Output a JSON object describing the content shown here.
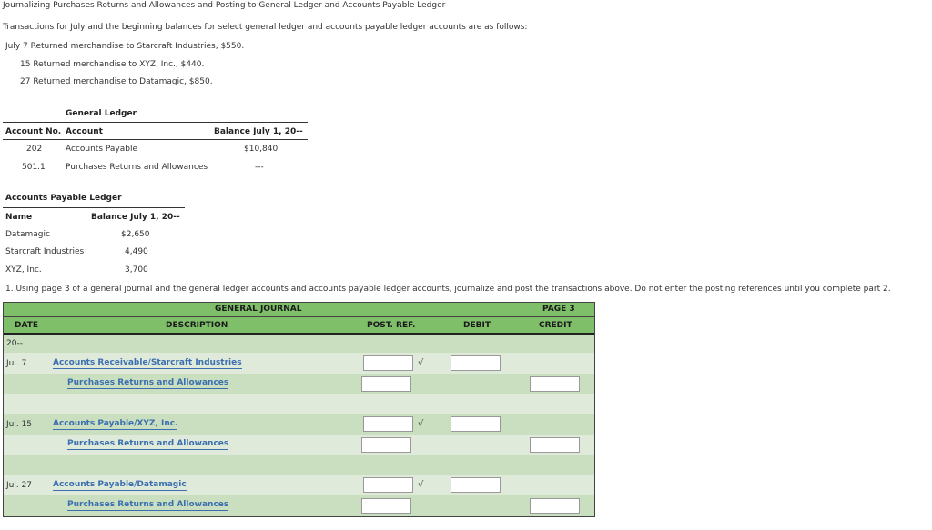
{
  "title": "Journalizing Purchases Returns and Allowances and Posting to General Ledger and Accounts Payable Ledger",
  "intro": "Transactions for July and the beginning balances for select general ledger and accounts payable ledger accounts are as follows:",
  "transactions": [
    "July 7 Returned merchandise to Starcraft Industries, $550.",
    "15 Returned merchandise to XYZ, Inc., $440.",
    "27 Returned merchandise to Datamagic, $850."
  ],
  "general_ledger": {
    "heading": "General Ledger",
    "col_no": "Account No.",
    "col_account": "Account",
    "col_balance": "Balance July 1, 20--",
    "rows": [
      {
        "no": "202",
        "account": "Accounts Payable",
        "balance": "$10,840"
      },
      {
        "no": "501.1",
        "account": "Purchases Returns and Allowances",
        "balance": "---"
      }
    ]
  },
  "ap_ledger": {
    "heading": "Accounts Payable Ledger",
    "col_name": "Name",
    "col_balance": "Balance July 1, 20--",
    "rows": [
      {
        "name": "Datamagic",
        "balance": "$2,650"
      },
      {
        "name": "Starcraft Industries",
        "balance": "4,490"
      },
      {
        "name": "XYZ, Inc.",
        "balance": "3,700"
      }
    ]
  },
  "instruction": "1. Using page 3 of a general journal and the general ledger accounts and accounts payable ledger accounts, journalize and post the transactions above. Do not enter the posting references until you complete part 2.",
  "journal": {
    "title": "GENERAL JOURNAL",
    "page": "PAGE 3",
    "col_date": "DATE",
    "col_desc": "DESCRIPTION",
    "col_post": "POST. REF.",
    "col_debit": "DEBIT",
    "col_credit": "CREDIT",
    "year": "20--",
    "check_mark": "√",
    "entries": [
      {
        "date": "Jul. 7",
        "debit_account": "Accounts Receivable/Starcraft Industries",
        "credit_account": "Purchases Returns and Allowances"
      },
      {
        "date": "Jul. 15",
        "debit_account": "Accounts Payable/XYZ, Inc.",
        "credit_account": "Purchases Returns and Allowances"
      },
      {
        "date": "Jul. 27",
        "debit_account": "Accounts Payable/Datamagic",
        "credit_account": "Purchases Returns and Allowances"
      }
    ]
  }
}
